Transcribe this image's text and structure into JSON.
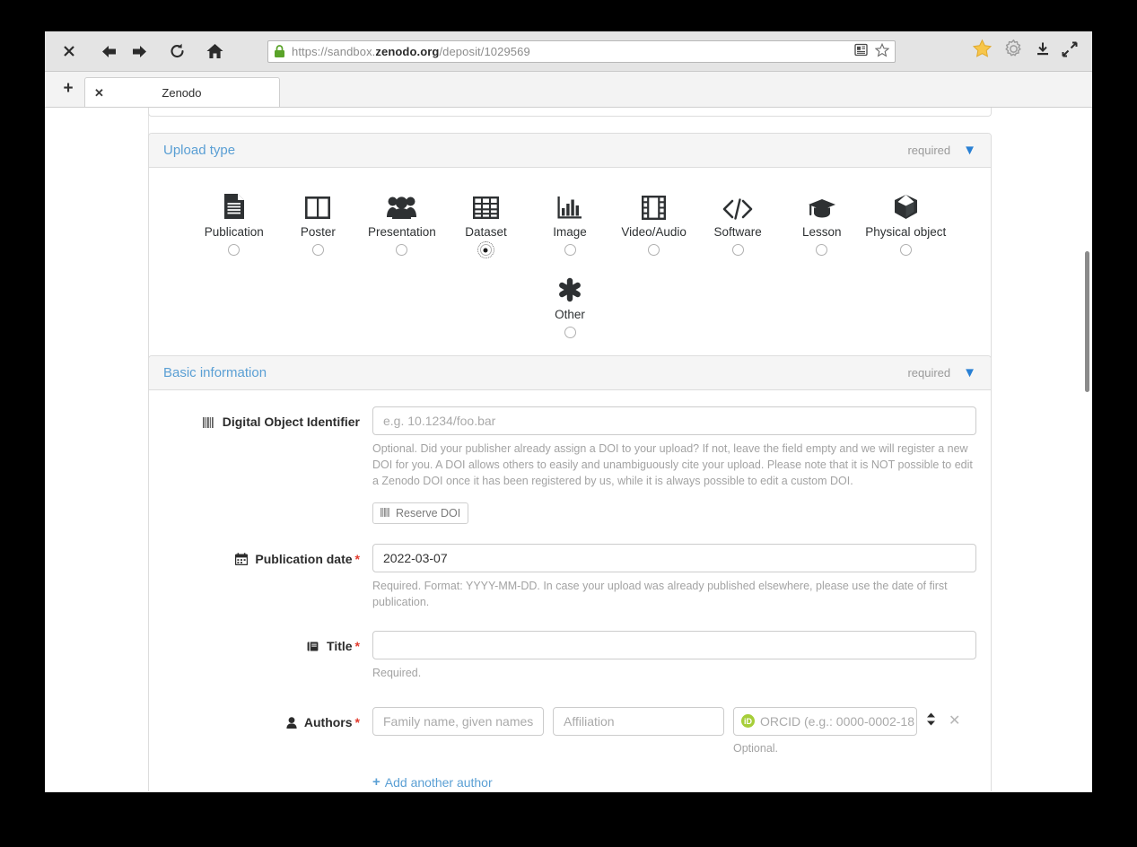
{
  "browser": {
    "nav": {
      "stop_label": "✕",
      "back": "back-arrow",
      "forward": "forward-arrow",
      "reload": "reload",
      "home": "home"
    },
    "url": {
      "scheme_host_prefix": "https://sandbox.",
      "domain": "zenodo.org",
      "path": "/deposit/1029569",
      "lock": "secure-lock"
    },
    "tabs": [
      {
        "title": "Zenodo",
        "close": "✕"
      }
    ],
    "new_tab_label": "+",
    "toolbar_right": [
      "bookmarks-star",
      "settings-gear",
      "downloads",
      "fullscreen"
    ]
  },
  "upload_type": {
    "title": "Upload type",
    "required_label": "required",
    "chevron": "▼",
    "options": [
      {
        "label": "Publication",
        "icon": "document-icon",
        "selected": false
      },
      {
        "label": "Poster",
        "icon": "poster-icon",
        "selected": false
      },
      {
        "label": "Presentation",
        "icon": "people-icon",
        "selected": false
      },
      {
        "label": "Dataset",
        "icon": "table-icon",
        "selected": true
      },
      {
        "label": "Image",
        "icon": "bar-chart-icon",
        "selected": false
      },
      {
        "label": "Video/Audio",
        "icon": "film-icon",
        "selected": false
      },
      {
        "label": "Software",
        "icon": "code-icon",
        "selected": false
      },
      {
        "label": "Lesson",
        "icon": "graduation-cap-icon",
        "selected": false
      },
      {
        "label": "Physical object",
        "icon": "cube-icon",
        "selected": false
      }
    ],
    "other": {
      "label": "Other",
      "icon": "asterisk-icon",
      "selected": false
    }
  },
  "basic_information": {
    "title": "Basic information",
    "required_label": "required",
    "chevron": "▼",
    "doi": {
      "label": "Digital Object Identifier",
      "icon": "barcode-icon",
      "value": "",
      "placeholder": "e.g. 10.1234/foo.bar",
      "help": "Optional. Did your publisher already assign a DOI to your upload? If not, leave the field empty and we will register a new DOI for you. A DOI allows others to easily and unambiguously cite your upload. Please note that it is NOT possible to edit a Zenodo DOI once it has been registered by us, while it is always possible to edit a custom DOI.",
      "reserve_button": "Reserve DOI"
    },
    "publication_date": {
      "label": "Publication date",
      "icon": "calendar-icon",
      "required": "*",
      "value": "2022-03-07",
      "help": "Required. Format: YYYY-MM-DD. In case your upload was already published elsewhere, please use the date of first publication."
    },
    "title_field": {
      "label": "Title",
      "icon": "book-icon",
      "required": "*",
      "value": "",
      "placeholder": "",
      "help": "Required."
    },
    "authors": {
      "label": "Authors",
      "icon": "user-icon",
      "required": "*",
      "name_placeholder": "Family name, given names",
      "affiliation_placeholder": "Affiliation",
      "orcid_placeholder": "ORCID (e.g.: 0000-0002-18",
      "orcid_badge": "iD",
      "orcid_help": "Optional.",
      "sort_icon": "sort-icon",
      "remove_icon": "remove-icon",
      "add_another": "Add another author",
      "add_plus": "+"
    }
  },
  "colors": {
    "link": "#5a9fd4",
    "chevron": "#2980d4",
    "required_star": "#e23b2e",
    "orcid_green": "#a6ce39",
    "panel_header_bg": "#f5f5f5"
  }
}
